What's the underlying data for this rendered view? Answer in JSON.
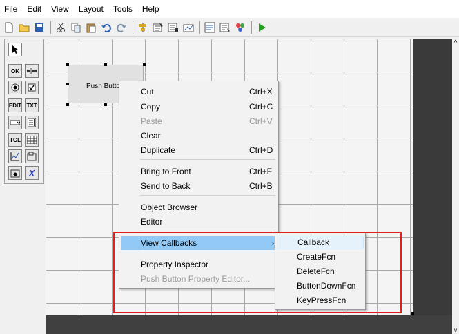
{
  "menubar": {
    "items": [
      "File",
      "Edit",
      "View",
      "Layout",
      "Tools",
      "Help"
    ]
  },
  "toolbar": {
    "icons": [
      "new-icon",
      "open-icon",
      "save-icon",
      "cut-icon",
      "copy-icon",
      "paste-icon",
      "undo-icon",
      "redo-icon",
      "align-icon",
      "menu-editor-icon",
      "tab-order-icon",
      "toolbar-editor-icon",
      "editor-icon",
      "property-inspector-icon",
      "object-browser-icon",
      "run-icon"
    ]
  },
  "palette": {
    "items": [
      "Select",
      "Push Button",
      "Slider",
      "Radio Button",
      "Check Box",
      "Edit Text",
      "Static Text",
      "Pop-up Menu",
      "List Box",
      "Toggle Button",
      "Table",
      "Axes",
      "Panel",
      "Button Group",
      "ActiveX Control"
    ],
    "glyphs": {
      "push": "OK",
      "edit": "EDIT",
      "text": "TXT",
      "toggle": "TGL",
      "x": "X"
    }
  },
  "canvas": {
    "push_button_label": "Push Button"
  },
  "context_menu": {
    "items": [
      {
        "label": "Cut",
        "shortcut": "Ctrl+X",
        "enabled": true
      },
      {
        "label": "Copy",
        "shortcut": "Ctrl+C",
        "enabled": true
      },
      {
        "label": "Paste",
        "shortcut": "Ctrl+V",
        "enabled": false
      },
      {
        "label": "Clear",
        "shortcut": "",
        "enabled": true
      },
      {
        "label": "Duplicate",
        "shortcut": "Ctrl+D",
        "enabled": true
      },
      {
        "label": "Bring to Front",
        "shortcut": "Ctrl+F",
        "enabled": true
      },
      {
        "label": "Send to Back",
        "shortcut": "Ctrl+B",
        "enabled": true
      },
      {
        "label": "Object Browser",
        "shortcut": "",
        "enabled": true
      },
      {
        "label": "Editor",
        "shortcut": "",
        "enabled": true
      },
      {
        "label": "View Callbacks",
        "shortcut": "",
        "enabled": true,
        "highlighted": true,
        "submenu": true
      },
      {
        "label": "Property Inspector",
        "shortcut": "",
        "enabled": true
      },
      {
        "label": "Push Button Property Editor...",
        "shortcut": "",
        "enabled": false
      }
    ],
    "submenu_arrow": "›"
  },
  "submenu": {
    "items": [
      "Callback",
      "CreateFcn",
      "DeleteFcn",
      "ButtonDownFcn",
      "KeyPressFcn"
    ]
  },
  "scrollbar": {
    "up_arrow": "^",
    "down_arrow": "v"
  },
  "colors": {
    "highlight": "#91c9f7",
    "annotation_red": "#e02020",
    "run_green": "#22a022"
  }
}
